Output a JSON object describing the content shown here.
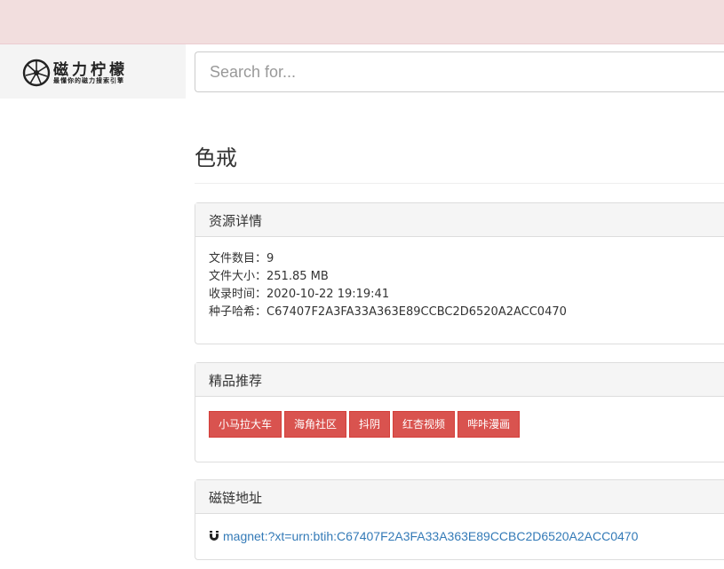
{
  "header": {
    "logo_title": "磁力柠檬",
    "logo_slogan": "最懂你的磁力搜索引擎",
    "search_placeholder": "Search for..."
  },
  "page": {
    "title": "色戒"
  },
  "details": {
    "heading": "资源详情",
    "file_count_label": "文件数目：",
    "file_count": "9",
    "file_size_label": "文件大小：",
    "file_size": "251.85 MB",
    "indexed_label": "收录时间：",
    "indexed_time": "2020-10-22 19:19:41",
    "hash_label": "种子哈希：",
    "hash": "C67407F2A3FA33A363E89CCBC2D6520A2ACC0470"
  },
  "recommend": {
    "heading": "精品推荐",
    "tags": [
      "小马拉大车",
      "海角社区",
      "抖阴",
      "红杏视频",
      "哔咔漫画"
    ]
  },
  "magnet": {
    "heading": "磁链地址",
    "link": "magnet:?xt=urn:btih:C67407F2A3FA33A363E89CCBC2D6520A2ACC0470",
    "icon": "magnet-icon"
  },
  "colors": {
    "banner": "#f2dede",
    "tag": "#d9534f",
    "link": "#337ab7"
  }
}
